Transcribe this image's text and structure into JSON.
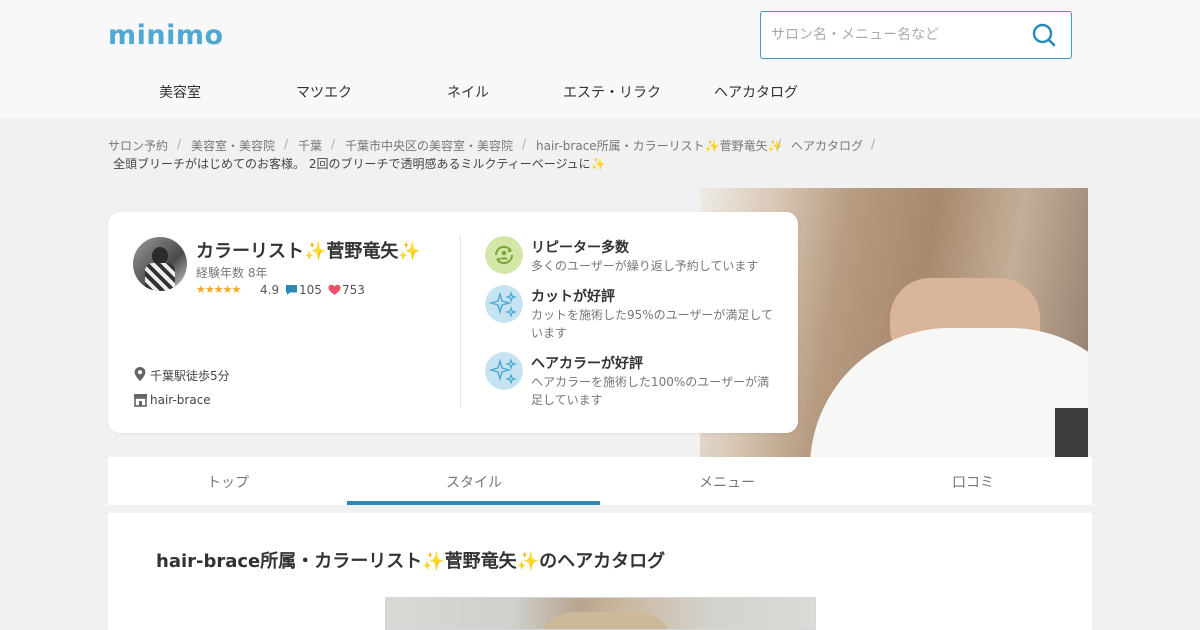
{
  "header": {
    "logo": "minimo",
    "search_placeholder": "サロン名・メニュー名など",
    "nav": [
      "美容室",
      "マツエク",
      "ネイル",
      "エステ・リラク",
      "ヘアカタログ"
    ]
  },
  "breadcrumb": {
    "items": [
      "サロン予約",
      "美容室・美容院",
      "千葉",
      "千葉市中央区の美容室・美容院",
      "hair-brace所属・カラーリスト✨菅野竜矢✨",
      "ヘアカタログ"
    ],
    "separator": "/",
    "current": "全頭ブリーチがはじめてのお客様。 2回のブリーチで透明感あるミルクティーベージュに✨"
  },
  "stylist": {
    "name": "カラーリスト✨菅野竜矢✨",
    "experience": "経験年数 8年",
    "stars": "★★★★★",
    "rating": "4.9",
    "messages": "105",
    "likes": "753",
    "access": "千葉駅徒歩5分",
    "salon": "hair-brace"
  },
  "features": [
    {
      "title": "リピーター多数",
      "desc": "多くのユーザーが繰り返し予約しています"
    },
    {
      "title": "カットが好評",
      "desc": "カットを施術した95%のユーザーが満足しています"
    },
    {
      "title": "ヘアカラーが好評",
      "desc": "ヘアカラーを施術した100%のユーザーが満足しています"
    }
  ],
  "tabs": [
    "トップ",
    "スタイル",
    "メニュー",
    "口コミ"
  ],
  "active_tab": "スタイル",
  "catalog_title": "hair-brace所属・カラーリスト✨菅野竜矢✨のヘアカタログ",
  "colors": {
    "brand": "#4fa9d3",
    "accent": "#2a8ab5",
    "star": "#f5a623",
    "heart": "#e8536b"
  }
}
